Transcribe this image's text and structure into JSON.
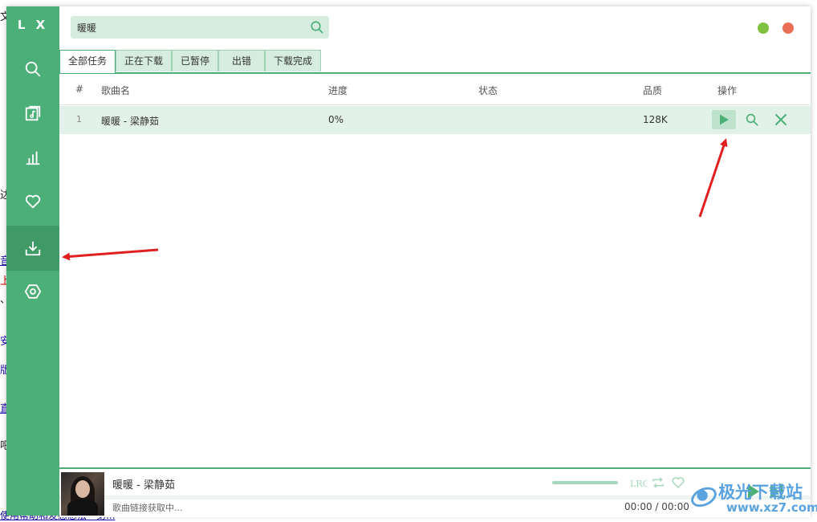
{
  "background_page": {
    "fragments": [
      "文",
      "达",
      "音",
      "上",
      "、",
      "安",
      "版",
      "直",
      "吧"
    ],
    "bottom_link": "使用帮助和发感想法 - 第..."
  },
  "sidebar": {
    "logo": "L X",
    "items": [
      {
        "id": "search",
        "icon": "search-icon"
      },
      {
        "id": "songlist",
        "icon": "music-list-icon"
      },
      {
        "id": "leaderboard",
        "icon": "chart-icon"
      },
      {
        "id": "favorites",
        "icon": "heart-icon"
      },
      {
        "id": "download",
        "icon": "download-icon",
        "active": true
      },
      {
        "id": "settings",
        "icon": "settings-icon"
      }
    ]
  },
  "search": {
    "value": "暖暖",
    "placeholder": ""
  },
  "tabs": [
    {
      "label": "全部任务",
      "active": true
    },
    {
      "label": "正在下载"
    },
    {
      "label": "已暂停"
    },
    {
      "label": "出错"
    },
    {
      "label": "下载完成"
    }
  ],
  "table": {
    "headers": {
      "index": "#",
      "name": "歌曲名",
      "progress": "进度",
      "status": "状态",
      "quality": "品质",
      "actions": "操作"
    },
    "rows": [
      {
        "index": "1",
        "name": "暖暖 - 梁静茹",
        "progress": "0%",
        "status": "",
        "quality": "128K"
      }
    ]
  },
  "player": {
    "title": "暖暖 - 梁静茹",
    "status": "歌曲链接获取中...",
    "time": "00:00 / 00:00",
    "lrc_label": "LRC"
  },
  "watermark": {
    "line1": "极光下载站",
    "line2": "www.xz7.com"
  },
  "colors": {
    "accent": "#4caf78",
    "accent_dark": "#3f9a68",
    "accent_light": "#d6ecde",
    "row_highlight": "#e3f2e8",
    "min_dot": "#7fc241",
    "close_dot": "#eb6f55",
    "arrow": "#e02020"
  }
}
